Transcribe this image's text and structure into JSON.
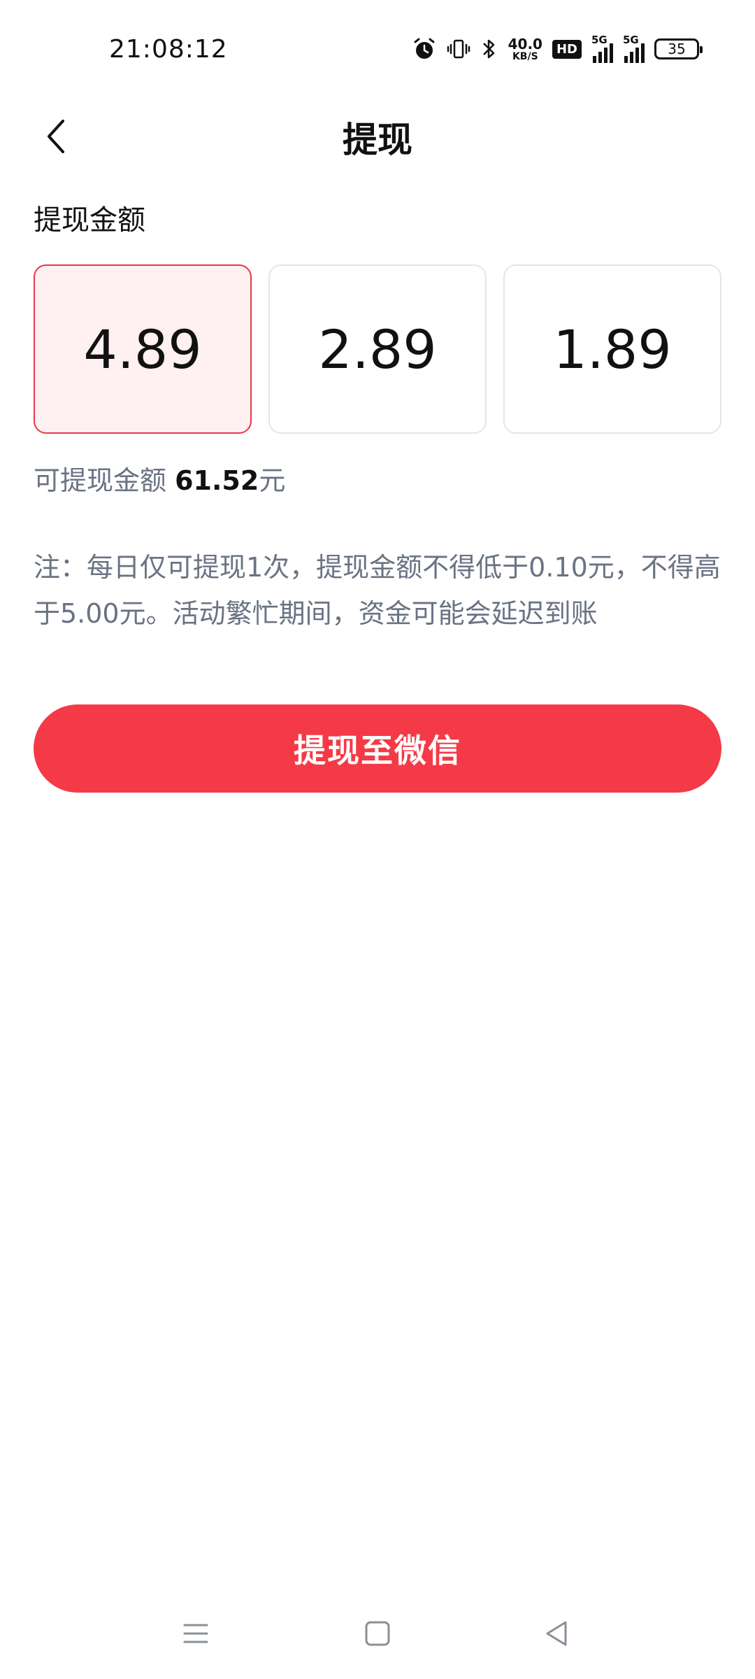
{
  "status_bar": {
    "time": "21:08:12",
    "net_speed_value": "40.0",
    "net_speed_unit": "KB/S",
    "hd_label": "HD",
    "signal1_label": "5G",
    "signal2_label": "5G",
    "battery_level": "35",
    "icons": [
      "alarm-icon",
      "vibrate-icon",
      "bluetooth-icon",
      "hd-icon",
      "signal-icon",
      "signal-icon",
      "battery-icon"
    ]
  },
  "header": {
    "title": "提现",
    "back_icon": "chevron-left-icon"
  },
  "withdraw": {
    "section_label": "提现金额",
    "options": [
      "4.89",
      "2.89",
      "1.89"
    ],
    "selected_index": 0,
    "available_label": "可提现金额",
    "available_amount": "61.52",
    "available_unit": "元",
    "note": "注：每日仅可提现1次，提现金额不得低于0.10元，不得高于5.00元。活动繁忙期间，资金可能会延迟到账",
    "button_label": "提现至微信"
  },
  "colors": {
    "accent": "#f43a47",
    "selected_border": "#e6394a",
    "selected_bg": "#fff0f1",
    "muted_text": "#6a7383"
  },
  "nav_bar": {
    "icons": [
      "menu-icon",
      "home-square-icon",
      "back-triangle-icon"
    ]
  }
}
